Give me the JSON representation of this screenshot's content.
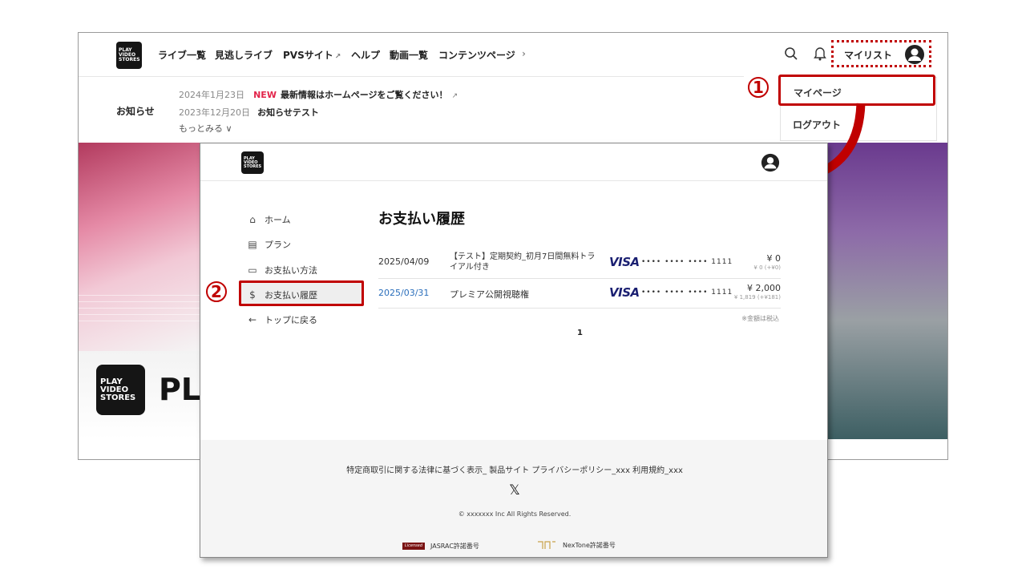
{
  "bg_site": {
    "logo_lines": [
      "PLAY",
      "VIDEO",
      "STORES"
    ],
    "nav": [
      "ライブ一覧",
      "見逃しライブ",
      "PVSサイト",
      "ヘルプ",
      "動画一覧",
      "コンテンツページ"
    ],
    "nav_more": "›",
    "news_label": "お知らせ",
    "news": [
      {
        "date": "2024年1月23日",
        "badge": "NEW",
        "text": "最新情報はホームページをご覧ください！"
      },
      {
        "date": "2023年12月20日",
        "badge": "",
        "text": "お知らせテスト"
      }
    ],
    "news_more": "もっとみる ∨",
    "mylist_label": "マイリスト",
    "dropdown": [
      "マイページ",
      "ログアウト"
    ],
    "hero_brand": "PL"
  },
  "front_site": {
    "logo_lines": [
      "PLAY",
      "VIDEO",
      "STORES"
    ],
    "sidebar": [
      {
        "icon": "home-icon",
        "label": "ホーム",
        "glyph": "⌂"
      },
      {
        "icon": "plan-icon",
        "label": "プラン",
        "glyph": "▤"
      },
      {
        "icon": "card-icon",
        "label": "お支払い方法",
        "glyph": "▭"
      },
      {
        "icon": "dollar-icon",
        "label": "お支払い履歴",
        "glyph": "$"
      },
      {
        "icon": "arrow-left-icon",
        "label": "トップに戻る",
        "glyph": "←"
      }
    ],
    "page_title": "お支払い履歴",
    "payments": [
      {
        "date": "2025/04/09",
        "desc_line1": "【テスト】定期契約_初月7日間無料トラ",
        "desc_line2": "イアル付き",
        "brand": "VISA",
        "card": "•••• •••• •••• 1111",
        "amount": "¥ 0",
        "tax": "¥ 0 (+¥0)"
      },
      {
        "date": "2025/03/31",
        "desc_line1": "プレミア公開視聴権",
        "desc_line2": "",
        "brand": "VISA",
        "card": "•••• •••• •••• 1111",
        "amount": "¥ 2,000",
        "tax": "¥ 1,819 (+¥181)"
      }
    ],
    "tax_note": "※金額は税込",
    "page_number": "1",
    "footer_links": "特定商取引に関する法律に基づく表示_ 製品サイト プライバシーポリシー_xxx 利用規約_xxx",
    "x_logo": "𝕏",
    "copyright": "© xxxxxxx Inc All Rights Reserved.",
    "jasrac_label": "JASRAC許諾番号",
    "jasrac_badge": "Licensed",
    "nextone_label": "NexTone許諾番号"
  },
  "callouts": {
    "one": "1",
    "two": "2"
  },
  "colors": {
    "callout_red": "#c00000",
    "new_badge": "#e2244a",
    "link_blue": "#2a6ebb",
    "visa_blue": "#1a1f71"
  }
}
